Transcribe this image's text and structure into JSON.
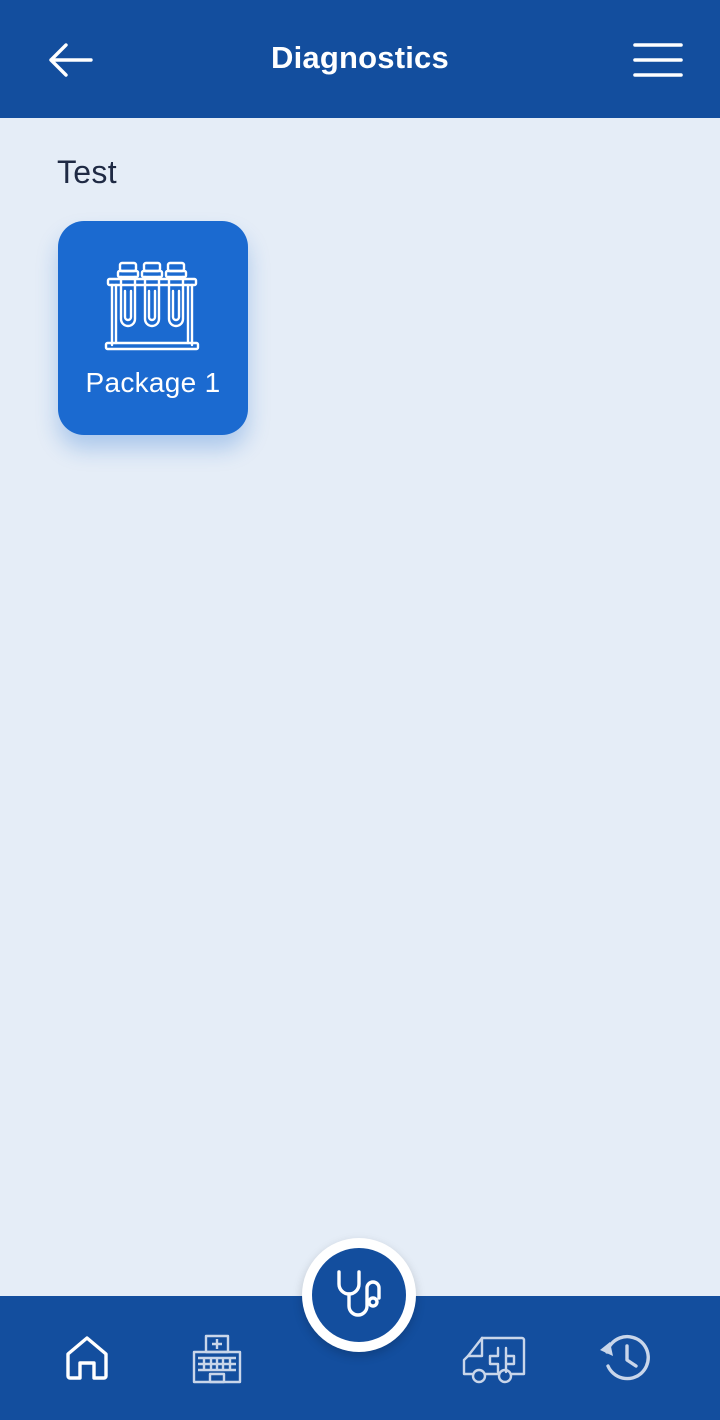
{
  "app_bar": {
    "title": "Diagnostics",
    "back_icon": "arrow-left-icon",
    "menu_icon": "hamburger-menu-icon",
    "background": "#134e9e"
  },
  "section": {
    "title": "Test"
  },
  "packages": [
    {
      "label": "Package 1",
      "icon": "test-tubes-rack-icon",
      "color": "#1b6ad0"
    }
  ],
  "bottom_nav": {
    "background": "#134e9e",
    "items": [
      {
        "icon": "home-icon"
      },
      {
        "icon": "hospital-icon"
      },
      {
        "icon": "stethoscope-icon"
      },
      {
        "icon": "ambulance-icon"
      },
      {
        "icon": "history-icon"
      }
    ]
  },
  "colors": {
    "page_background": "#e5edf7",
    "primary": "#134e9e",
    "card": "#1b6ad0",
    "text_dark": "#1f2a44"
  }
}
